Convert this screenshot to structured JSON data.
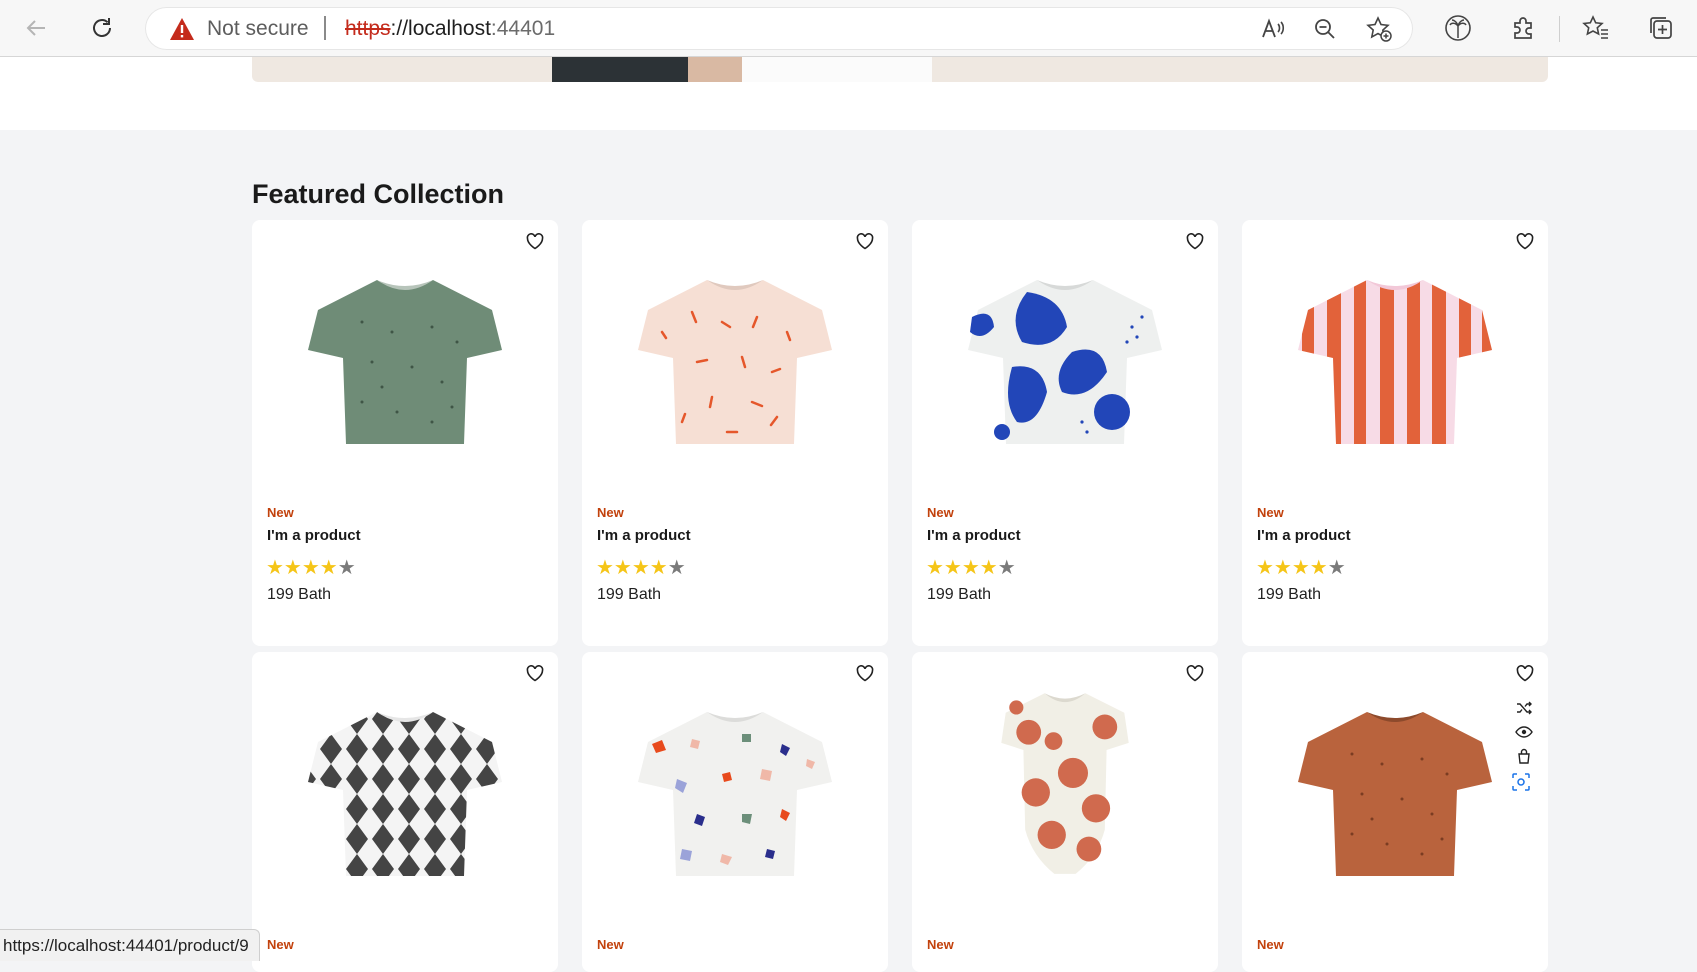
{
  "browser": {
    "security_label": "Not secure",
    "url_scheme": "https",
    "url_rest": "://localhost",
    "url_port": ":44401",
    "status_url": "https://localhost:44401/product/9"
  },
  "section": {
    "title": "Featured Collection"
  },
  "products": [
    {
      "badge": "New",
      "name": "I'm a product",
      "rating": 4,
      "max_rating": 5,
      "price": "199 Bath",
      "image": "green-tshirt"
    },
    {
      "badge": "New",
      "name": "I'm a product",
      "rating": 4,
      "max_rating": 5,
      "price": "199 Bath",
      "image": "peach-confetti-tshirt"
    },
    {
      "badge": "New",
      "name": "I'm a product",
      "rating": 4,
      "max_rating": 5,
      "price": "199 Bath",
      "image": "blue-blob-tshirt"
    },
    {
      "badge": "New",
      "name": "I'm a product",
      "rating": 4,
      "max_rating": 5,
      "price": "199 Bath",
      "image": "orange-stripe-tshirt"
    },
    {
      "badge": "New",
      "image": "diamond-pattern-tshirt"
    },
    {
      "badge": "New",
      "image": "terrazzo-tshirt"
    },
    {
      "badge": "New",
      "image": "polka-dot-bodysuit"
    },
    {
      "badge": "New",
      "image": "rust-tshirt"
    }
  ],
  "colors": {
    "badge": "#c2410c",
    "star": "#f5c518",
    "star_empty": "#7a7a7a"
  }
}
